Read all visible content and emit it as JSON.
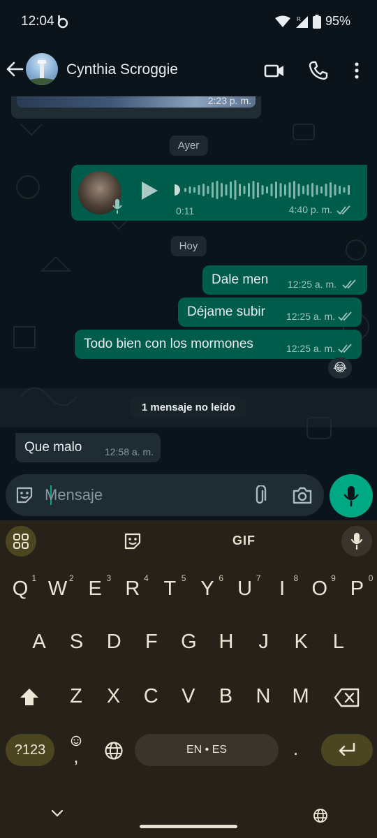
{
  "status_bar": {
    "time": "12:04",
    "battery": "95%"
  },
  "header": {
    "contact_name": "Cynthia Scroggie"
  },
  "chat": {
    "image_message_time": "2:23 p. m.",
    "date_yesterday": "Ayer",
    "voice_message": {
      "duration": "0:11",
      "time": "4:40 p. m."
    },
    "date_today": "Hoy",
    "outgoing": [
      {
        "text": "Dale men",
        "time": "12:25 a. m."
      },
      {
        "text": "Déjame subir",
        "time": "12:25 a. m."
      },
      {
        "text": "Todo bien con los mormones",
        "time": "12:25 a. m."
      }
    ],
    "reaction": "😂",
    "unread_banner": "1 mensaje no leído",
    "incoming": [
      {
        "text": "Que malo",
        "time": "12:58 a. m."
      }
    ]
  },
  "composer": {
    "placeholder": "Mensaje"
  },
  "keyboard": {
    "gif_label": "GIF",
    "row1": [
      "Q",
      "W",
      "E",
      "R",
      "T",
      "Y",
      "U",
      "I",
      "O",
      "P"
    ],
    "row1_hints": [
      "1",
      "2",
      "3",
      "4",
      "5",
      "6",
      "7",
      "8",
      "9",
      "0"
    ],
    "row2": [
      "A",
      "S",
      "D",
      "F",
      "G",
      "H",
      "J",
      "K",
      "L"
    ],
    "row3": [
      "Z",
      "X",
      "C",
      "V",
      "B",
      "N",
      "M"
    ],
    "symbols_label": "?123",
    "comma": ",",
    "space_label": "EN • ES",
    "period": "."
  }
}
